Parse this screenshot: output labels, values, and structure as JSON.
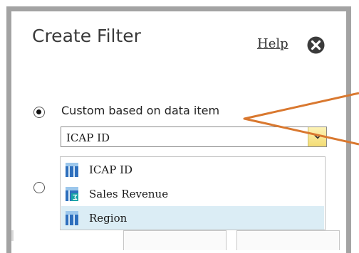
{
  "dialog": {
    "title": "Create Filter",
    "help_label": "Help"
  },
  "options": {
    "custom": {
      "label": "Custom based on data item",
      "checked": true
    },
    "second": {
      "checked": false
    }
  },
  "dropdown": {
    "selected_value": "ICAP ID",
    "items": [
      {
        "label": "ICAP ID",
        "icon": "dimension-icon",
        "highlighted": false
      },
      {
        "label": "Sales Revenue",
        "icon": "measure-icon",
        "highlighted": false
      },
      {
        "label": "Region",
        "icon": "dimension-icon",
        "highlighted": true
      }
    ]
  },
  "colors": {
    "callout": "#d9782f",
    "icon_blue": "#2e6fbd",
    "icon_accent": "#17a3a6",
    "selected_row": "#dbedf5",
    "frame": "#a3a3a3"
  }
}
